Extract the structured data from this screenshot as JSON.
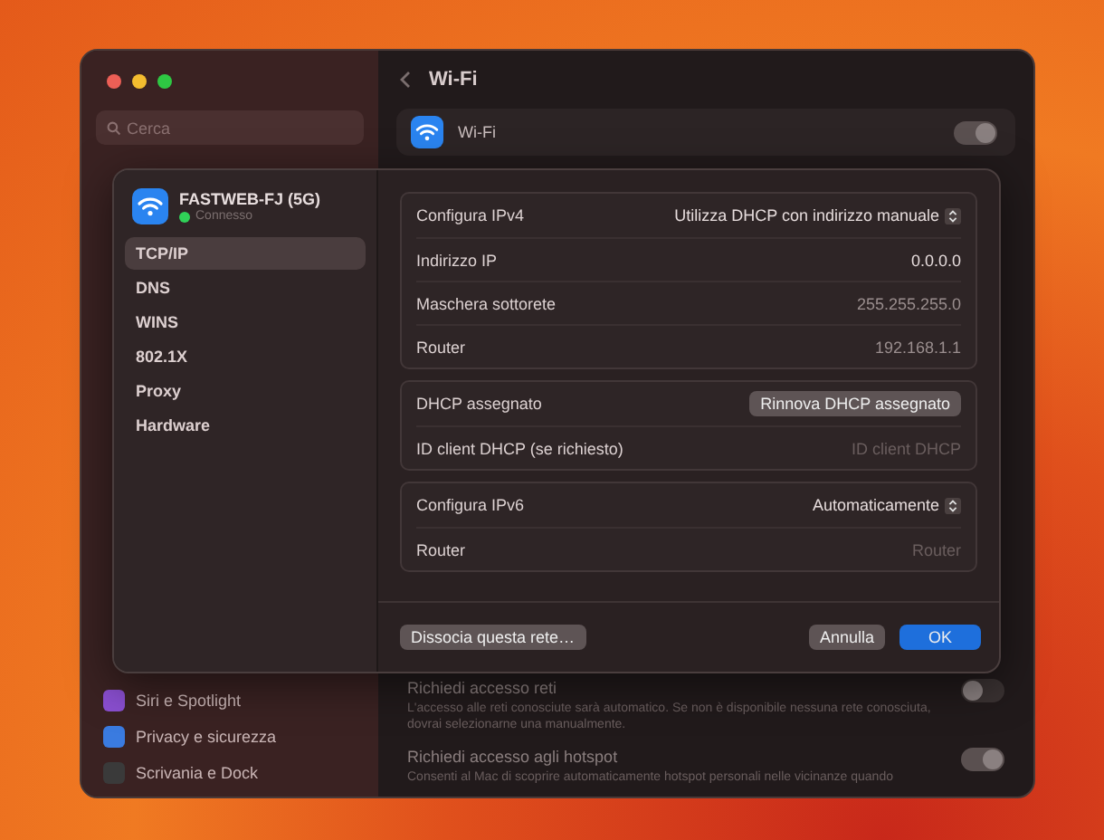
{
  "window": {
    "title": "Wi-Fi",
    "search": {
      "placeholder": "Cerca"
    },
    "sidebar_items": [
      {
        "label": "Siri e Spotlight",
        "color": "#8a4fd0"
      },
      {
        "label": "Privacy e sicurezza",
        "color": "#3a7be0"
      },
      {
        "label": "Scrivania e Dock",
        "color": "#3a3a3a"
      }
    ],
    "wifi_row": {
      "label": "Wi-Fi",
      "on": true
    },
    "settings": [
      {
        "title": "Richiedi accesso reti",
        "description": "L'accesso alle reti conosciute sarà automatico. Se non è disponibile nessuna rete conosciuta, dovrai selezionarne una manualmente.",
        "on": false
      },
      {
        "title": "Richiedi accesso agli hotspot",
        "description": "Consenti al Mac di scoprire automaticamente hotspot personali nelle vicinanze quando",
        "on": true
      }
    ]
  },
  "sheet": {
    "network": {
      "name": "FASTWEB-FJ (5G)",
      "status": "Connesso",
      "connected": true
    },
    "tabs": [
      {
        "label": "TCP/IP",
        "selected": true
      },
      {
        "label": "DNS",
        "selected": false
      },
      {
        "label": "WINS",
        "selected": false
      },
      {
        "label": "802.1X",
        "selected": false
      },
      {
        "label": "Proxy",
        "selected": false
      },
      {
        "label": "Hardware",
        "selected": false
      }
    ],
    "groups": [
      {
        "rows": [
          {
            "label": "Configura IPv4",
            "value": "Utilizza DHCP con indirizzo manuale",
            "kind": "popup"
          },
          {
            "label": "Indirizzo IP",
            "value": "0.0.0.0",
            "kind": "text"
          },
          {
            "label": "Maschera sottorete",
            "value": "255.255.255.0",
            "kind": "muted"
          },
          {
            "label": "Router",
            "value": "192.168.1.1",
            "kind": "muted"
          }
        ]
      },
      {
        "rows": [
          {
            "label": "DHCP assegnato",
            "value": "Rinnova DHCP assegnato",
            "kind": "button"
          },
          {
            "label": "ID client DHCP (se richiesto)",
            "placeholder": "ID client DHCP",
            "kind": "field"
          }
        ]
      },
      {
        "rows": [
          {
            "label": "Configura IPv6",
            "value": "Automaticamente",
            "kind": "popup"
          },
          {
            "label": "Router",
            "placeholder": "Router",
            "kind": "field"
          }
        ]
      }
    ],
    "footer": {
      "forget": "Dissocia questa rete…",
      "cancel": "Annulla",
      "ok": "OK"
    }
  }
}
